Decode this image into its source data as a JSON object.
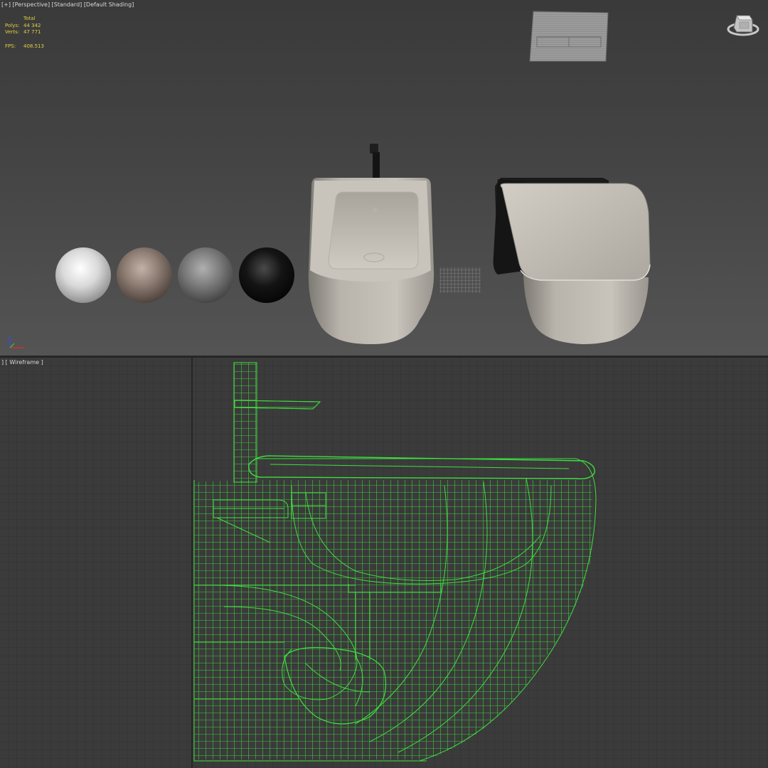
{
  "top_viewport": {
    "labels": {
      "menu": "[+]",
      "view": "[Perspective]",
      "shading_mode": "[Standard]",
      "shading": "[Default Shading]"
    },
    "stats": {
      "header": "Total",
      "polys_label": "Polys:",
      "polys_value": "44 342",
      "verts_label": "Verts:",
      "verts_value": "47 771",
      "fps_label": "FPS:",
      "fps_value": "408.513"
    },
    "material_spheres": [
      "white-ceramic",
      "taupe",
      "grey",
      "black"
    ],
    "objects": [
      "flush-plate",
      "bidet",
      "faucet",
      "wall-hung-toilet",
      "drain-grid"
    ],
    "icons": [
      "viewcube-icon",
      "axis-gizmo-icon"
    ]
  },
  "bottom_viewport": {
    "labels": {
      "menu": "]",
      "shading": "[ Wireframe ]"
    },
    "wire_color": "#3de03d"
  }
}
